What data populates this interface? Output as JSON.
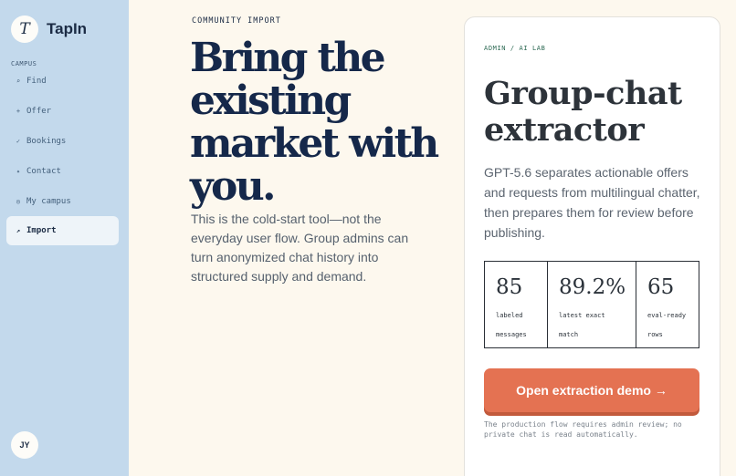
{
  "brand": {
    "mark": "T",
    "name": "TapIn"
  },
  "sidebar": {
    "section_label": "CAMPUS",
    "items": [
      {
        "icon": "⌕",
        "label": "Find"
      },
      {
        "icon": "+",
        "label": "Offer"
      },
      {
        "icon": "✓",
        "label": "Bookings"
      },
      {
        "icon": "✦",
        "label": "Contact"
      },
      {
        "icon": "◎",
        "label": "My campus"
      },
      {
        "icon": "↗",
        "label": "Import"
      }
    ],
    "active_item": "Import",
    "avatar_initials": "JY"
  },
  "hero": {
    "eyebrow": "COMMUNITY IMPORT",
    "title": "Bring the existing market with you.",
    "body": "This is the cold-start tool—not the everyday user flow. Group admins can turn anonymized chat history into structured supply and demand."
  },
  "card": {
    "eyebrow": "ADMIN / AI LAB",
    "title": "Group-chat extractor",
    "body": "GPT-5.6 separates actionable offers and requests from multilingual chatter, then prepares them for review before publishing.",
    "stats": [
      {
        "value": "85",
        "label": "labeled messages"
      },
      {
        "value": "89.2%",
        "label": "latest exact match"
      },
      {
        "value": "65",
        "label": "eval-ready rows"
      }
    ],
    "cta_label": "Open extraction demo →",
    "footnote": "The production flow requires admin review; no private chat is read automatically."
  },
  "colors": {
    "sidebar_bg": "#c3d9ec",
    "page_bg": "#fdf8ee",
    "accent": "#e47252",
    "ink": "#15284a",
    "label_green": "#2f6b55"
  }
}
